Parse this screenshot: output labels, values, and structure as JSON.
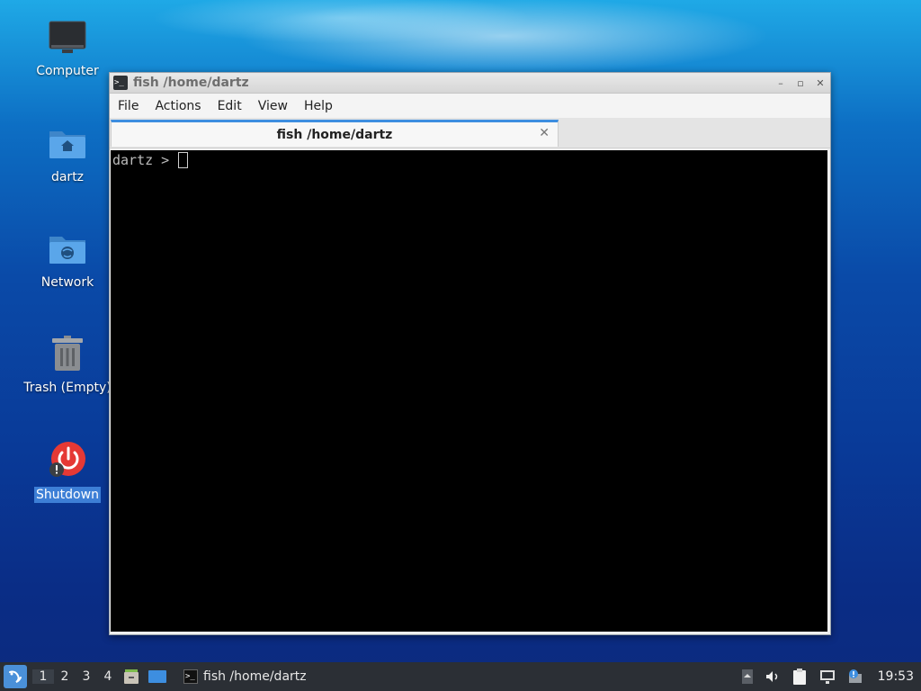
{
  "desktop": {
    "icons": [
      {
        "label": "Computer",
        "icon": "computer-icon"
      },
      {
        "label": "dartz",
        "icon": "home-folder-icon"
      },
      {
        "label": "Network",
        "icon": "network-folder-icon"
      },
      {
        "label": "Trash (Empty)",
        "icon": "trash-icon"
      },
      {
        "label": "Shutdown",
        "icon": "shutdown-icon",
        "selected": true
      }
    ]
  },
  "window": {
    "title": "fish /home/dartz",
    "buttons": {
      "minimize": "–",
      "restore": "▫",
      "close": "✕"
    },
    "menu": [
      "File",
      "Actions",
      "Edit",
      "View",
      "Help"
    ],
    "tab": {
      "label": "fish /home/dartz",
      "close": "✕"
    },
    "terminal": {
      "prompt": "dartz > "
    }
  },
  "taskbar": {
    "workspaces": [
      "1",
      "2",
      "3",
      "4"
    ],
    "active_workspace": "1",
    "task": {
      "label": "fish /home/dartz"
    },
    "clock": "19:53"
  },
  "colors": {
    "accent": "#3d8ee0",
    "taskbar_bg": "#2b2f35",
    "terminal_bg": "#000000",
    "shutdown_red": "#e53935"
  }
}
